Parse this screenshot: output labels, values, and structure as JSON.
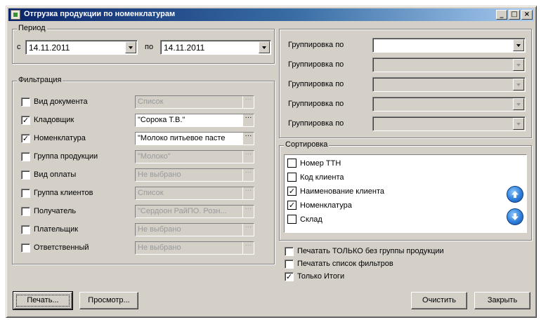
{
  "window": {
    "title": "Отгрузка продукции по номенклатурам",
    "minimize": "_",
    "maximize": "□",
    "close": "×"
  },
  "period": {
    "legend": "Период",
    "from_label": "с",
    "from_value": "14.11.2011",
    "to_label": "по",
    "to_value": "14.11.2011"
  },
  "filters": {
    "legend": "Фильтрация",
    "items": [
      {
        "label": "Вид документа",
        "checked": false,
        "value": "Список"
      },
      {
        "label": "Кладовщик",
        "checked": true,
        "value": "\"Сорока Т.В.\""
      },
      {
        "label": "Номенклатура",
        "checked": true,
        "value": "\"Молоко питьевое пасте"
      },
      {
        "label": "Группа продукции",
        "checked": false,
        "value": "\"Молоко\""
      },
      {
        "label": "Вид оплаты",
        "checked": false,
        "value": "Не выбрано"
      },
      {
        "label": "Группа клиентов",
        "checked": false,
        "value": "Список"
      },
      {
        "label": "Получатель",
        "checked": false,
        "value": "\"Сердоон РайПО. Розн..."
      },
      {
        "label": "Плательщик",
        "checked": false,
        "value": "Не выбрано"
      },
      {
        "label": "Ответственный",
        "checked": false,
        "value": "Не выбрано"
      }
    ]
  },
  "grouping": {
    "items": [
      {
        "label": "Группировка по",
        "value": "",
        "enabled": true
      },
      {
        "label": "Группировка по",
        "value": "",
        "enabled": false
      },
      {
        "label": "Группировка по",
        "value": "",
        "enabled": false
      },
      {
        "label": "Группировка по",
        "value": "",
        "enabled": false
      },
      {
        "label": "Группировка по",
        "value": "",
        "enabled": false
      }
    ]
  },
  "sorting": {
    "legend": "Сортировка",
    "items": [
      {
        "label": "Номер ТТН",
        "checked": false
      },
      {
        "label": "Код клиента",
        "checked": false
      },
      {
        "label": "Наименование клиента",
        "checked": true
      },
      {
        "label": "Номенклатура",
        "checked": true
      },
      {
        "label": "Склад",
        "checked": false
      }
    ]
  },
  "options": [
    {
      "label": "Печатать ТОЛЬКО без группы продукции",
      "checked": false
    },
    {
      "label": "Печатать список фильтров",
      "checked": false
    },
    {
      "label": "Только Итоги",
      "checked": true
    }
  ],
  "buttons": {
    "print": "Печать...",
    "preview": "Просмотр...",
    "clear": "Очистить",
    "close": "Закрыть"
  },
  "glyphs": {
    "check": "✓",
    "ellipsis": "···"
  }
}
